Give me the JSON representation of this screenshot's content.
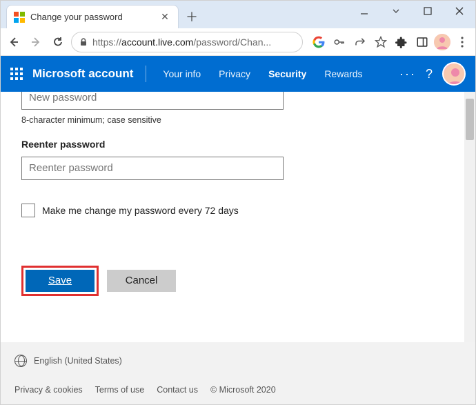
{
  "window": {
    "tab_title": "Change your password"
  },
  "address": {
    "scheme": "https://",
    "host": "account.live.com",
    "path": "/password/Chan..."
  },
  "header": {
    "brand": "Microsoft account",
    "nav": {
      "your_info": "Your info",
      "privacy": "Privacy",
      "security": "Security",
      "rewards": "Rewards"
    }
  },
  "form": {
    "new_password_placeholder": "New password",
    "helper": "8-character minimum; case sensitive",
    "reenter_label": "Reenter password",
    "reenter_placeholder": "Reenter password",
    "checkbox_label": "Make me change my password every 72 days",
    "save_label": "Save",
    "cancel_label": "Cancel"
  },
  "footer": {
    "language": "English (United States)",
    "privacy": "Privacy & cookies",
    "terms": "Terms of use",
    "contact": "Contact us",
    "copyright": "© Microsoft 2020"
  }
}
